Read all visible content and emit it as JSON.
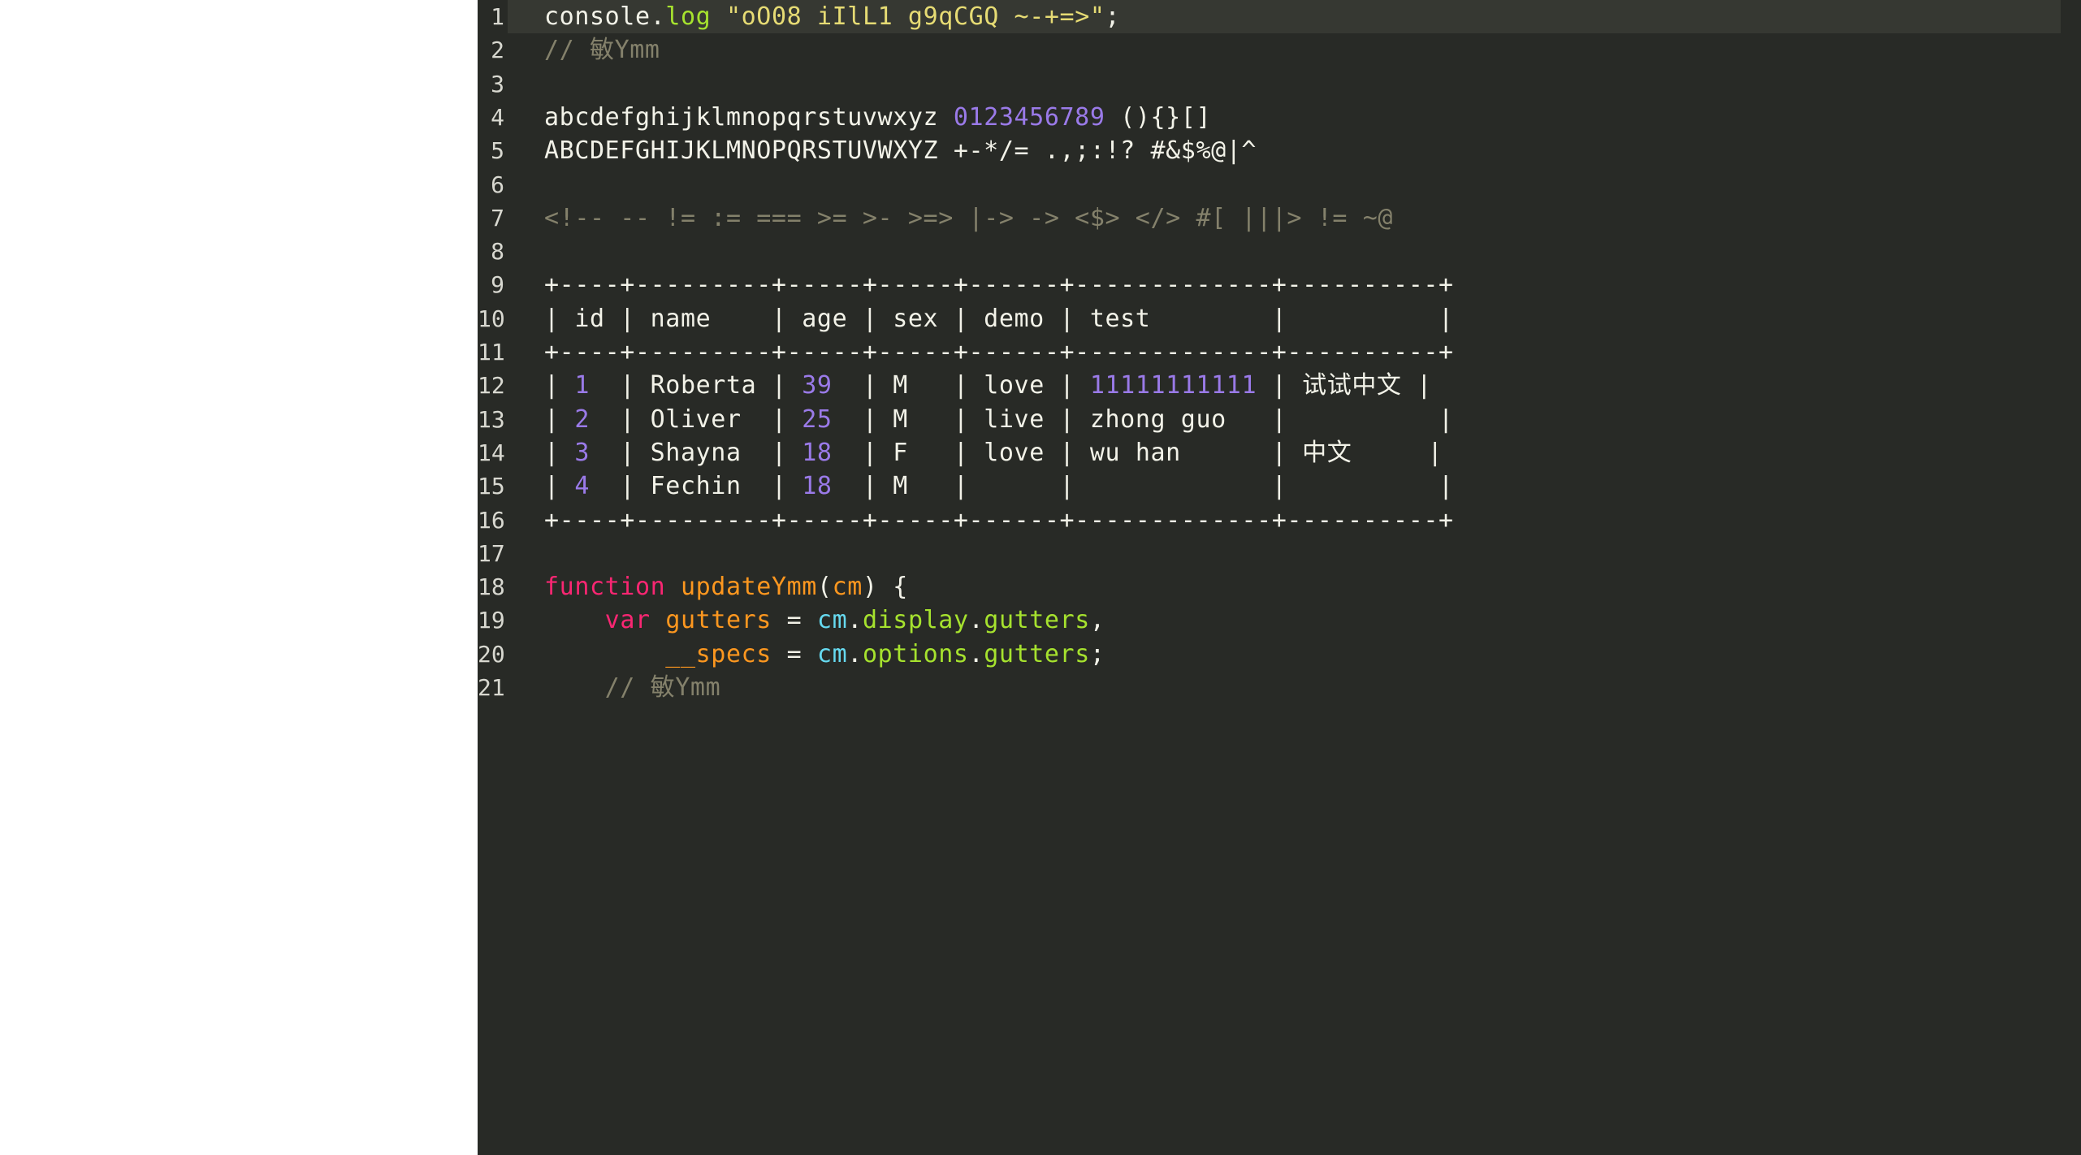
{
  "editor": {
    "theme_name": "monokai-dark",
    "background_color": "#282a26",
    "active_line_color": "#363832",
    "gutter_text_color": "#d8d8d0",
    "margin_color": "#ffffff",
    "active_line_number": 1,
    "font_size_px": 30,
    "line_height_px": 41.3
  },
  "colors": {
    "plain": "#f2f2e8",
    "comment": "#84816b",
    "string": "#e6db74",
    "number": "#9a7ae8",
    "function": "#a6e22e",
    "keyword": "#f92672",
    "variable": "#fd971f",
    "object": "#66d9ef",
    "property": "#a6e22e"
  },
  "gutter": {
    "numbers": [
      "1",
      "2",
      "3",
      "4",
      "5",
      "6",
      "7",
      "8",
      "9",
      "10",
      "11",
      "12",
      "13",
      "14",
      "15",
      "16",
      "17",
      "18",
      "19",
      "20",
      "21"
    ]
  },
  "lines": [
    {
      "num": "1",
      "active": true,
      "tokens": [
        {
          "text": "console",
          "type": "plain"
        },
        {
          "text": ".",
          "type": "plain"
        },
        {
          "text": "log",
          "type": "function"
        },
        {
          "text": " ",
          "type": "plain"
        },
        {
          "text": "\"oO08 iIlL1 g9qCGQ ~-+=>\"",
          "type": "string"
        },
        {
          "text": ";",
          "type": "plain"
        }
      ]
    },
    {
      "num": "2",
      "active": false,
      "tokens": [
        {
          "text": "// ",
          "type": "comment"
        },
        {
          "text": "敏",
          "type": "comment-cjk"
        },
        {
          "text": "Ymm",
          "type": "comment"
        }
      ]
    },
    {
      "num": "3",
      "active": false,
      "tokens": []
    },
    {
      "num": "4",
      "active": false,
      "tokens": [
        {
          "text": "abcdefghijklmnopqrstuvwxyz ",
          "type": "plain"
        },
        {
          "text": "0123456789",
          "type": "number"
        },
        {
          "text": " (){}[]",
          "type": "plain"
        }
      ]
    },
    {
      "num": "5",
      "active": false,
      "tokens": [
        {
          "text": "ABCDEFGHIJKLMNOPQRSTUVWXYZ +-*/= .,;:!? #&$%@|^",
          "type": "plain"
        }
      ]
    },
    {
      "num": "6",
      "active": false,
      "tokens": []
    },
    {
      "num": "7",
      "active": false,
      "tokens": [
        {
          "text": "<!-- -- != := === >= >- >=> |-> -> <$> </> #[ |||> != ~@",
          "type": "comment"
        }
      ]
    },
    {
      "num": "8",
      "active": false,
      "tokens": []
    },
    {
      "num": "9",
      "active": false,
      "tokens": [
        {
          "text": "+----+---------+-----+-----+------+-------------+----------+",
          "type": "plain"
        }
      ]
    },
    {
      "num": "10",
      "active": false,
      "tokens": [
        {
          "text": "| id | name    | age | sex | demo | test        |          |",
          "type": "plain"
        }
      ]
    },
    {
      "num": "11",
      "active": false,
      "tokens": [
        {
          "text": "+----+---------+-----+-----+------+-------------+----------+",
          "type": "plain"
        }
      ]
    },
    {
      "num": "12",
      "active": false,
      "tokens": [
        {
          "text": "| ",
          "type": "plain"
        },
        {
          "text": "1",
          "type": "number"
        },
        {
          "text": "  | Roberta | ",
          "type": "plain"
        },
        {
          "text": "39",
          "type": "number"
        },
        {
          "text": "  | M   | love | ",
          "type": "plain"
        },
        {
          "text": "11111111111",
          "type": "number"
        },
        {
          "text": " | ",
          "type": "plain"
        },
        {
          "text": "试试中文",
          "type": "plain-cjk"
        },
        {
          "text": " |",
          "type": "plain"
        }
      ]
    },
    {
      "num": "13",
      "active": false,
      "tokens": [
        {
          "text": "| ",
          "type": "plain"
        },
        {
          "text": "2",
          "type": "number"
        },
        {
          "text": "  | Oliver  | ",
          "type": "plain"
        },
        {
          "text": "25",
          "type": "number"
        },
        {
          "text": "  | M   | live | zhong guo   |          |",
          "type": "plain"
        }
      ]
    },
    {
      "num": "14",
      "active": false,
      "tokens": [
        {
          "text": "| ",
          "type": "plain"
        },
        {
          "text": "3",
          "type": "number"
        },
        {
          "text": "  | Shayna  | ",
          "type": "plain"
        },
        {
          "text": "18",
          "type": "number"
        },
        {
          "text": "  | F   | love | wu han      | ",
          "type": "plain"
        },
        {
          "text": "中文",
          "type": "plain-cjk"
        },
        {
          "text": "     |",
          "type": "plain"
        }
      ]
    },
    {
      "num": "15",
      "active": false,
      "tokens": [
        {
          "text": "| ",
          "type": "plain"
        },
        {
          "text": "4",
          "type": "number"
        },
        {
          "text": "  | Fechin  | ",
          "type": "plain"
        },
        {
          "text": "18",
          "type": "number"
        },
        {
          "text": "  | M   |      |             |          |",
          "type": "plain"
        }
      ]
    },
    {
      "num": "16",
      "active": false,
      "tokens": [
        {
          "text": "+----+---------+-----+-----+------+-------------+----------+",
          "type": "plain"
        }
      ]
    },
    {
      "num": "17",
      "active": false,
      "tokens": []
    },
    {
      "num": "18",
      "active": false,
      "tokens": [
        {
          "text": "function",
          "type": "keyword"
        },
        {
          "text": " ",
          "type": "plain"
        },
        {
          "text": "updateYmm",
          "type": "variable"
        },
        {
          "text": "(",
          "type": "plain"
        },
        {
          "text": "cm",
          "type": "variable"
        },
        {
          "text": ") {",
          "type": "plain"
        }
      ]
    },
    {
      "num": "19",
      "active": false,
      "tokens": [
        {
          "text": "    ",
          "type": "plain"
        },
        {
          "text": "var",
          "type": "keyword"
        },
        {
          "text": " ",
          "type": "plain"
        },
        {
          "text": "gutters",
          "type": "variable"
        },
        {
          "text": " = ",
          "type": "plain"
        },
        {
          "text": "cm",
          "type": "object"
        },
        {
          "text": ".",
          "type": "plain"
        },
        {
          "text": "display",
          "type": "property"
        },
        {
          "text": ".",
          "type": "plain"
        },
        {
          "text": "gutters",
          "type": "property"
        },
        {
          "text": ",",
          "type": "plain"
        }
      ]
    },
    {
      "num": "20",
      "active": false,
      "tokens": [
        {
          "text": "        ",
          "type": "plain"
        },
        {
          "text": "__specs",
          "type": "variable"
        },
        {
          "text": " = ",
          "type": "plain"
        },
        {
          "text": "cm",
          "type": "object"
        },
        {
          "text": ".",
          "type": "plain"
        },
        {
          "text": "options",
          "type": "property"
        },
        {
          "text": ".",
          "type": "plain"
        },
        {
          "text": "gutters",
          "type": "property"
        },
        {
          "text": ";",
          "type": "plain"
        }
      ]
    },
    {
      "num": "21",
      "active": false,
      "tokens": [
        {
          "text": "    // ",
          "type": "comment"
        },
        {
          "text": "敏",
          "type": "comment-cjk"
        },
        {
          "text": "Ymm",
          "type": "comment"
        }
      ]
    }
  ]
}
